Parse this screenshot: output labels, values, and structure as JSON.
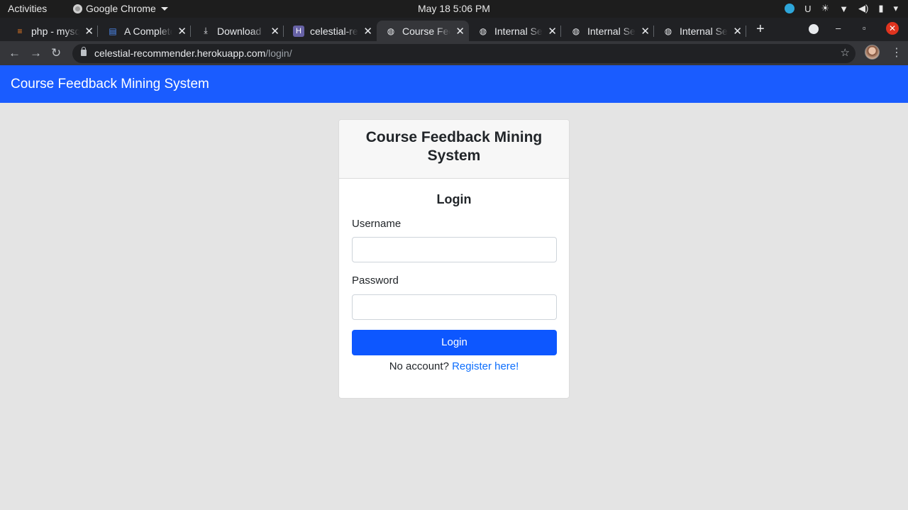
{
  "os": {
    "activities": "Activities",
    "app_name": "Google Chrome",
    "clock": "May 18  5:06 PM"
  },
  "browser": {
    "tabs": [
      {
        "label": "php - mysq",
        "icon": "stackoverflow-icon"
      },
      {
        "label": "A Complete",
        "icon": "document-icon"
      },
      {
        "label": "Download",
        "icon": "download-icon"
      },
      {
        "label": "celestial-re",
        "icon": "heroku-icon"
      },
      {
        "label": "Course Fee",
        "icon": "globe-icon",
        "active": true
      },
      {
        "label": "Internal Se",
        "icon": "globe-icon"
      },
      {
        "label": "Internal Se",
        "icon": "globe-icon"
      },
      {
        "label": "Internal Se",
        "icon": "globe-icon"
      }
    ],
    "url_host": "celestial-recommender.herokuapp.com",
    "url_path": "/login/"
  },
  "page": {
    "brand": "Course Feedback Mining System",
    "card_title_line1": "Course Feedback Mining",
    "card_title_line2": "System",
    "login_title": "Login",
    "username_label": "Username",
    "username_value": "",
    "password_label": "Password",
    "password_value": "",
    "login_button": "Login",
    "no_account": "No account?",
    "register_link": "Register here!"
  }
}
